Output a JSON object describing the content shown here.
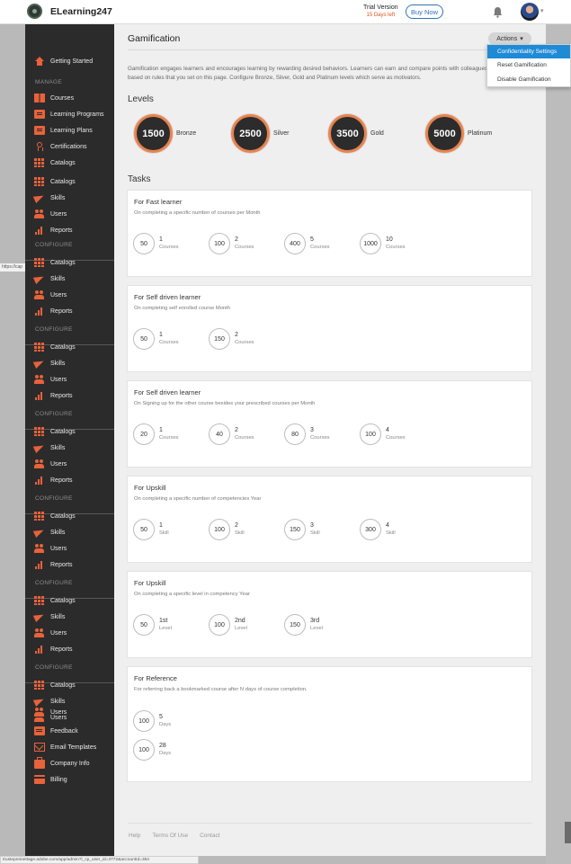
{
  "header": {
    "brand": "ELearning247",
    "trial_title": "Trial Version",
    "trial_days": "15 Days left",
    "buy_now": "Buy Now"
  },
  "sidebar": {
    "getting_started": "Getting Started",
    "manage_heading": "MANAGE",
    "manage_items": [
      {
        "label": "Courses",
        "icon": "book-icon"
      },
      {
        "label": "Learning Programs",
        "icon": "program-icon"
      },
      {
        "label": "Learning Plans",
        "icon": "plan-icon"
      },
      {
        "label": "Certifications",
        "icon": "certificate-icon"
      },
      {
        "label": "Catalogs",
        "icon": "grid-icon"
      },
      {
        "label": "Catalogs",
        "icon": "grid-icon"
      },
      {
        "label": "Skills",
        "icon": "plane-icon"
      },
      {
        "label": "Users",
        "icon": "users-icon"
      },
      {
        "label": "Reports",
        "icon": "bar-chart-icon"
      }
    ],
    "configure_heading": "CONFIGURE",
    "configure_items": [
      "Catalogs",
      "Skills",
      "Users",
      "Reports"
    ],
    "tail_items": [
      {
        "label": "Feedback",
        "icon": "feedback-icon"
      },
      {
        "label": "Email Templates",
        "icon": "email-icon"
      },
      {
        "label": "Company Info",
        "icon": "briefcase-icon"
      },
      {
        "label": "Billing",
        "icon": "credit-card-icon"
      }
    ],
    "url_fragment": "https://cap"
  },
  "main": {
    "title": "Gamification",
    "actions_label": "Actions",
    "intro": "Gamification engages learners and encourages learning by rewarding desired behaviors. Learners can earn and compare points with colleagues based on rules that you set on this page. Configure Bronze, Silver, Gold and Platinum levels which serve as motivators.",
    "levels_heading": "Levels",
    "tasks_heading": "Tasks"
  },
  "actions_menu": [
    "Confidentiality Settings",
    "Reset Gamification",
    "Disable Gamification"
  ],
  "levels": [
    {
      "points": "1500",
      "name": "Bronze"
    },
    {
      "points": "2500",
      "name": "Silver"
    },
    {
      "points": "3500",
      "name": "Gold"
    },
    {
      "points": "5000",
      "name": "Platinum"
    }
  ],
  "tasks": [
    {
      "title": "For Fast learner",
      "subtitle": "On completing a specific number of courses per Month",
      "rewards": [
        {
          "points": "50",
          "count": "1",
          "unit": "Courses"
        },
        {
          "points": "100",
          "count": "2",
          "unit": "Courses"
        },
        {
          "points": "400",
          "count": "5",
          "unit": "Courses"
        },
        {
          "points": "1000",
          "count": "10",
          "unit": "Courses"
        }
      ]
    },
    {
      "title": "For Self driven learner",
      "subtitle": "On completing self enrolled course Month",
      "rewards": [
        {
          "points": "50",
          "count": "1",
          "unit": "Courses"
        },
        {
          "points": "150",
          "count": "2",
          "unit": "Courses"
        }
      ]
    },
    {
      "title": "For Self driven learner",
      "subtitle": "On Signing up for the other course besides your prescribed courses per Month",
      "rewards": [
        {
          "points": "20",
          "count": "1",
          "unit": "Courses"
        },
        {
          "points": "40",
          "count": "2",
          "unit": "Courses"
        },
        {
          "points": "80",
          "count": "3",
          "unit": "Courses"
        },
        {
          "points": "100",
          "count": "4",
          "unit": "Courses"
        }
      ]
    },
    {
      "title": "For Upskill",
      "subtitle": "On completing a specific number of competencies Year",
      "rewards": [
        {
          "points": "50",
          "count": "1",
          "unit": "Skill"
        },
        {
          "points": "100",
          "count": "2",
          "unit": "Skill"
        },
        {
          "points": "150",
          "count": "3",
          "unit": "Skill"
        },
        {
          "points": "300",
          "count": "4",
          "unit": "Skill"
        }
      ]
    },
    {
      "title": "For Upskill",
      "subtitle": "On completing a specific level in competency Year",
      "rewards": [
        {
          "points": "50",
          "count": "1st",
          "unit": "Level"
        },
        {
          "points": "100",
          "count": "2nd",
          "unit": "Level"
        },
        {
          "points": "150",
          "count": "3rd",
          "unit": "Level"
        }
      ]
    },
    {
      "title": "For Reference",
      "subtitle": "For referring back a bookmarked course after N days of course completion.",
      "rewards": [
        {
          "points": "100",
          "count": "5",
          "unit": "Days"
        },
        {
          "points": "100",
          "count": "28",
          "unit": "Days"
        }
      ]
    }
  ],
  "footer": [
    "Help",
    "Terms Of Use",
    "Contact"
  ],
  "status_url": "trustepreinettage.adobe.com/app/admin?l_cp_user_id=3772&accountId=354",
  "colors": {
    "accent": "#e8623a",
    "link": "#2f73b8",
    "menu_active": "#1f8ad6",
    "sidebar": "#2b2b2b"
  }
}
